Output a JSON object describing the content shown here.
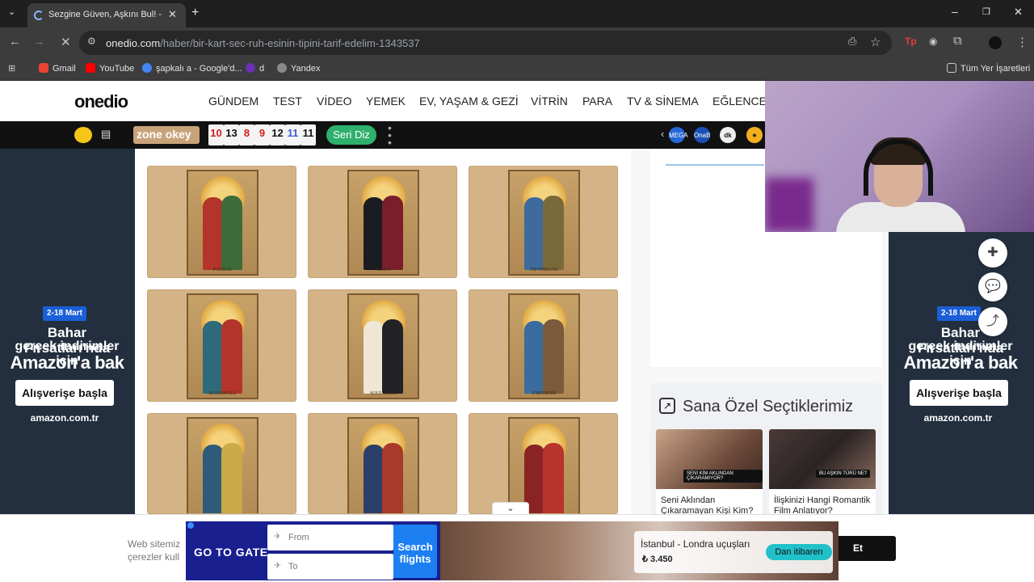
{
  "browser": {
    "tab_title": "Sezgine Güven, Aşkını Bul! - On",
    "url_domain": "onedio.com",
    "url_path": "/haber/bir-kart-sec-ruh-esinin-tipini-tarif-edelim-1343537",
    "bookmarks": [
      "Gmail",
      "YouTube",
      "şapkalı a - Google'd...",
      "d",
      "Yandex"
    ],
    "all_bookmarks": "Tüm Yer İşaretleri"
  },
  "site": {
    "logo": "onedio",
    "nav": [
      "GÜNDEM",
      "TEST",
      "VİDEO",
      "YEMEK",
      "EV, YAŞAM & GEZİ",
      "VİTRİN",
      "PARA",
      "TV & SİNEMA",
      "EĞLENCE"
    ]
  },
  "zone": {
    "logo": "zone okey",
    "tiles": [
      "10",
      "13",
      "8",
      "9",
      "12",
      "11",
      "11"
    ],
    "tile_colors": [
      "#d11e1e",
      "#111111",
      "#d11e1e",
      "#d11e1e",
      "#111111",
      "#3d5bd6",
      "#111111"
    ],
    "cta": "Seri Diz",
    "badges": [
      "MEGA",
      "OnaB",
      "dk",
      "★"
    ]
  },
  "cards": [
    {
      "label": "POURAL"
    },
    {
      "label": "NITINY"
    },
    {
      "label": "TIIVHIBANE"
    },
    {
      "label": "BLESSNGLE"
    },
    {
      "label": "SOUL MATE"
    },
    {
      "label": "JORNNERS"
    },
    {
      "label": ""
    },
    {
      "label": ""
    },
    {
      "label": ""
    }
  ],
  "ads": {
    "date": "2-18 Mart",
    "line1": "Bahar Fırsatları'nda",
    "line2": "gerçek indirimler için",
    "line3": "Amazon'a bak",
    "cta": "Alışverişe başla",
    "brand": "amazon.com.tr"
  },
  "picks": {
    "title": "Sana Özel Seçtiklerimiz",
    "items": [
      {
        "caption": "Seni Aklından Çıkaramayan Kişi Kim?",
        "tag": "SENİ KİM AKLINDAN ÇIKARAMIYOR?"
      },
      {
        "caption": "İlişkinizi Hangi Romantik Film Anlatıyor?",
        "tag": "BU AŞKIN TÜRÜ NE?"
      }
    ]
  },
  "cookie": {
    "text_line1": "Web sitemiz",
    "text_line2": "çerezler kull",
    "accept": "Et"
  },
  "banner": {
    "brand": "GO TO GATE",
    "from": "From",
    "to": "To",
    "search": "Search flights",
    "route": "İstanbul - Londra uçuşları",
    "price": "₺ 3.450",
    "pill": "Dan itibaren"
  }
}
